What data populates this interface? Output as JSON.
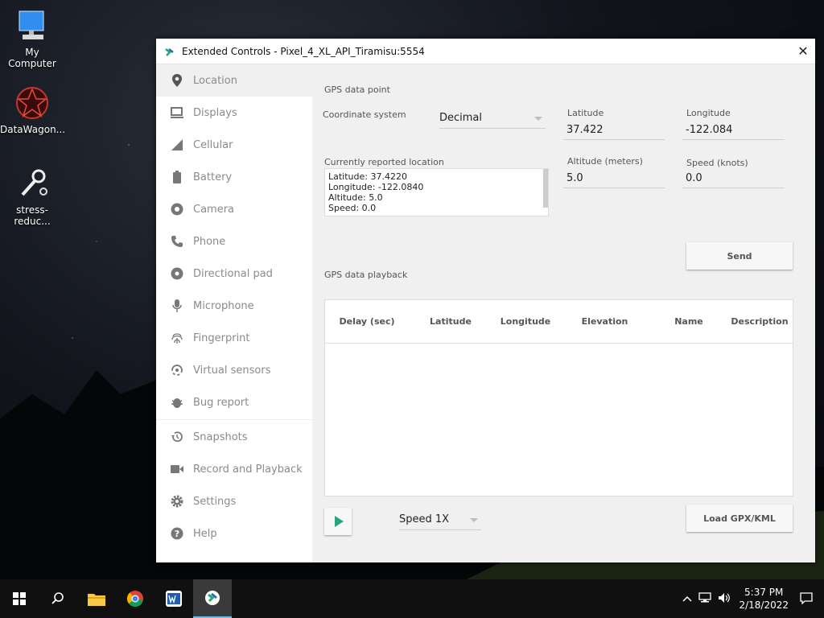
{
  "desktop": {
    "icons": [
      {
        "label": "My Computer"
      },
      {
        "label": "DataWagon..."
      },
      {
        "label": "stress-reduc..."
      }
    ]
  },
  "window": {
    "title": "Extended Controls - Pixel_4_XL_API_Tiramisu:5554",
    "close_glyph": "✕"
  },
  "sidebar": {
    "items": [
      {
        "label": "Location",
        "icon": "location-pin-icon"
      },
      {
        "label": "Displays",
        "icon": "display-icon"
      },
      {
        "label": "Cellular",
        "icon": "signal-icon"
      },
      {
        "label": "Battery",
        "icon": "battery-icon"
      },
      {
        "label": "Camera",
        "icon": "camera-icon"
      },
      {
        "label": "Phone",
        "icon": "phone-icon"
      },
      {
        "label": "Directional pad",
        "icon": "dpad-icon"
      },
      {
        "label": "Microphone",
        "icon": "microphone-icon"
      },
      {
        "label": "Fingerprint",
        "icon": "fingerprint-icon"
      },
      {
        "label": "Virtual sensors",
        "icon": "sensors-icon"
      },
      {
        "label": "Bug report",
        "icon": "bug-icon"
      },
      {
        "label": "Snapshots",
        "icon": "history-icon"
      },
      {
        "label": "Record and Playback",
        "icon": "video-camera-icon"
      },
      {
        "label": "Settings",
        "icon": "gear-icon"
      },
      {
        "label": "Help",
        "icon": "help-icon"
      }
    ]
  },
  "gps_point": {
    "section_title": "GPS data point",
    "coord_system_label": "Coordinate system",
    "coord_system_value": "Decimal",
    "latitude_label": "Latitude",
    "latitude_value": "37.422",
    "longitude_label": "Longitude",
    "longitude_value": "-122.084",
    "reported_label": "Currently reported location",
    "reported_lines": [
      "Latitude: 37.4220",
      "Longitude: -122.0840",
      "Altitude: 5.0",
      "Speed: 0.0"
    ],
    "altitude_label": "Altitude (meters)",
    "altitude_value": "5.0",
    "speed_label": "Speed (knots)",
    "speed_value": "0.0",
    "send_label": "Send"
  },
  "playback": {
    "section_title": "GPS data playback",
    "columns": [
      "Delay (sec)",
      "Latitude",
      "Longitude",
      "Elevation",
      "Name",
      "Description"
    ],
    "speed_value": "Speed 1X",
    "load_label": "Load GPX/KML"
  },
  "taskbar": {
    "time": "5:37 PM",
    "date": "2/18/2022"
  },
  "colors": {
    "accent_green": "#27a67a",
    "window_bg": "#f0f0f0"
  }
}
